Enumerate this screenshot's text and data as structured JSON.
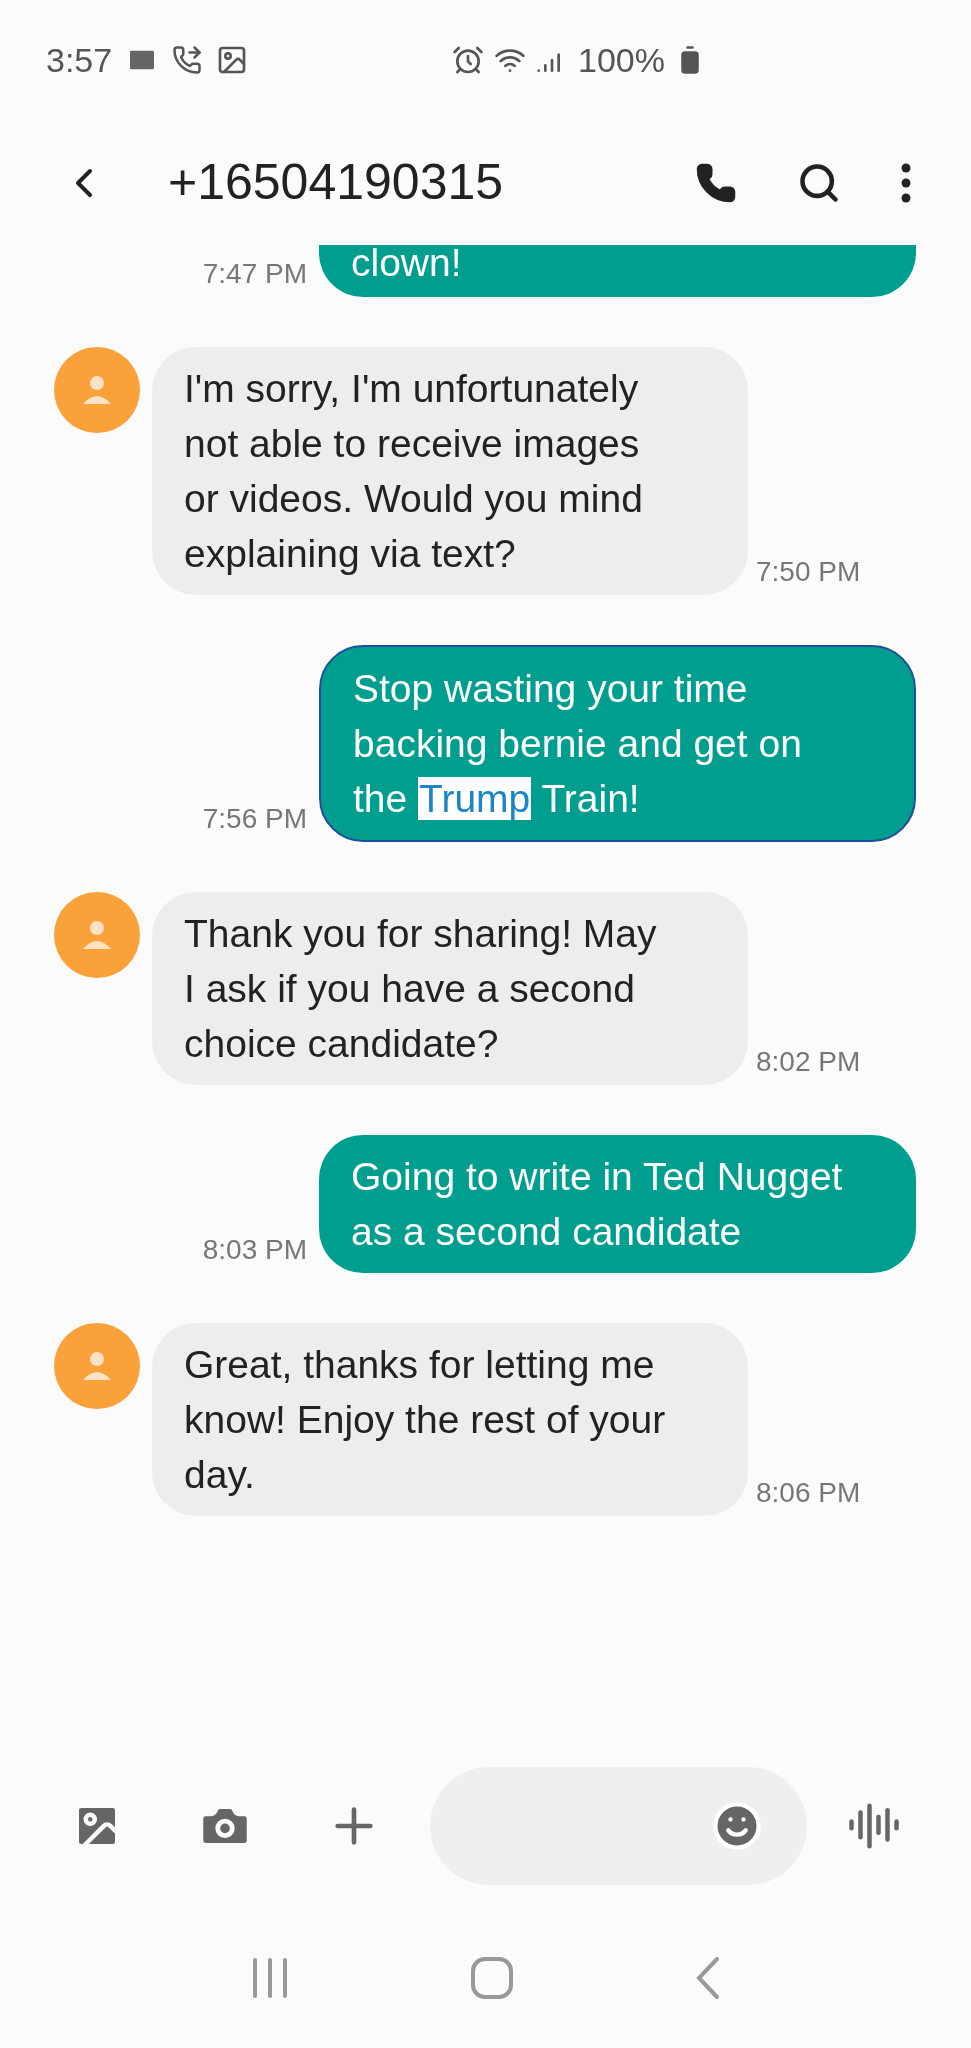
{
  "status_bar": {
    "time": "3:57",
    "battery": "100%"
  },
  "header": {
    "title": "+16504190315"
  },
  "messages": [
    {
      "kind": "outgoing",
      "selected": false,
      "time": "7:47 PM",
      "segments": [
        {
          "text": "clown!",
          "highlighted": false
        }
      ]
    },
    {
      "kind": "incoming",
      "selected": false,
      "time": "7:50 PM",
      "segments": [
        {
          "text": "I'm sorry, I'm unfortunately not able to receive images or videos. Would you mind explaining via text?",
          "highlighted": false
        }
      ]
    },
    {
      "kind": "outgoing",
      "selected": true,
      "time": "7:56 PM",
      "segments": [
        {
          "text": "Stop wasting your time backing bernie and get on the ",
          "highlighted": false
        },
        {
          "text": "Trump",
          "highlighted": true
        },
        {
          "text": " Train!",
          "highlighted": false
        }
      ]
    },
    {
      "kind": "incoming",
      "selected": false,
      "time": "8:02 PM",
      "segments": [
        {
          "text": "Thank you for sharing! May I ask if you have a second choice candidate?",
          "highlighted": false
        }
      ]
    },
    {
      "kind": "outgoing",
      "selected": false,
      "time": "8:03 PM",
      "segments": [
        {
          "text": "Going to write in Ted Nugget as a second candidate",
          "highlighted": false
        }
      ]
    },
    {
      "kind": "incoming",
      "selected": false,
      "time": "8:06 PM",
      "segments": [
        {
          "text": "Great, thanks for letting me know! Enjoy the rest of your day.",
          "highlighted": false
        }
      ]
    }
  ]
}
